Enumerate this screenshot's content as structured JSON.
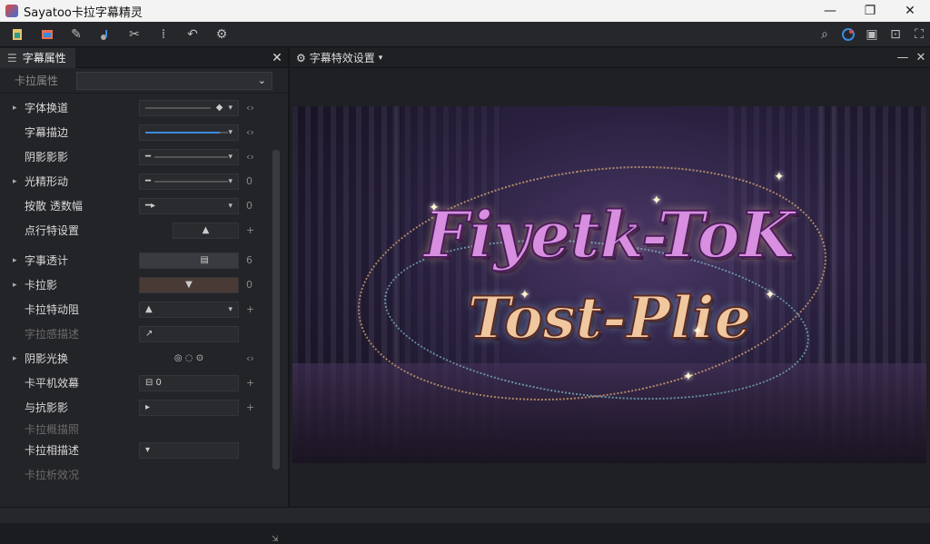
{
  "window": {
    "title": "Sayatoo卡拉字幕精灵"
  },
  "title_controls": {
    "minimize": "—",
    "restore": "❐",
    "close": "✕"
  },
  "toolbar": {
    "left_icons": [
      "new-file-icon",
      "open-file-icon",
      "edit-icon",
      "audio-icon",
      "cut-icon",
      "timing-icon",
      "undo-icon",
      "settings-gear-icon"
    ],
    "right_icons": [
      "search-icon",
      "color-icon",
      "export-icon",
      "render-icon",
      "fullscreen-icon"
    ]
  },
  "left_panel": {
    "tab_label": "字幕属性",
    "close": "✕",
    "header_label": "卡拉属性",
    "header_dropdown": "⌄",
    "rows": [
      {
        "label": "字体换道",
        "arrow": "▸",
        "control": "◆",
        "end": "‹›"
      },
      {
        "label": "字幕描边",
        "arrow": "",
        "control": "",
        "end": "‹›"
      },
      {
        "label": "阴影影影",
        "arrow": "",
        "control": "━",
        "end": "‹›"
      },
      {
        "label": "光精形动",
        "arrow": "▸",
        "control": "━",
        "end": "0"
      },
      {
        "label": "按散 透数幅",
        "arrow": "",
        "control": "━▸",
        "end": "0"
      },
      {
        "label": "点行特设置",
        "arrow": "",
        "control": "▲",
        "end": "+"
      },
      {
        "label": "字事透计",
        "arrow": "▸",
        "control": "▤",
        "end": "6"
      },
      {
        "label": "卡拉影",
        "arrow": "▸",
        "control": "▼",
        "end": "0"
      },
      {
        "label": "卡拉特动阻",
        "arrow": "",
        "control": "▲",
        "end": "+"
      },
      {
        "label": "字拉感描述",
        "arrow": "",
        "control": "↗",
        "end": ""
      },
      {
        "label": "阴影光换",
        "arrow": "▸",
        "control": "◎ ◌ ⊙",
        "end": "‹›"
      },
      {
        "label": "卡平机效幕",
        "arrow": "",
        "control": "⊟ 0",
        "end": "+"
      },
      {
        "label": "与抗影影",
        "arrow": "",
        "control": "▸",
        "end": "+"
      },
      {
        "label": "卡拉概描照",
        "arrow": "",
        "control": "",
        "end": ""
      },
      {
        "label": "卡拉相描述",
        "arrow": "",
        "control": "▾",
        "end": ""
      },
      {
        "label": "卡拉析效况",
        "arrow": "",
        "control": "",
        "end": ""
      }
    ]
  },
  "right_panel": {
    "tab_label": "字幕特效设置",
    "caret": "▾",
    "controls": [
      "—",
      "✕"
    ]
  },
  "preview": {
    "line1": "Fiyetk-ToK",
    "line2": "Tost-Plie"
  },
  "colors": {
    "accent_blue": "#3b8be0",
    "panel_bg": "#232428",
    "title_purple": "#d88fe0",
    "title_gold": "#f0c8a0"
  }
}
